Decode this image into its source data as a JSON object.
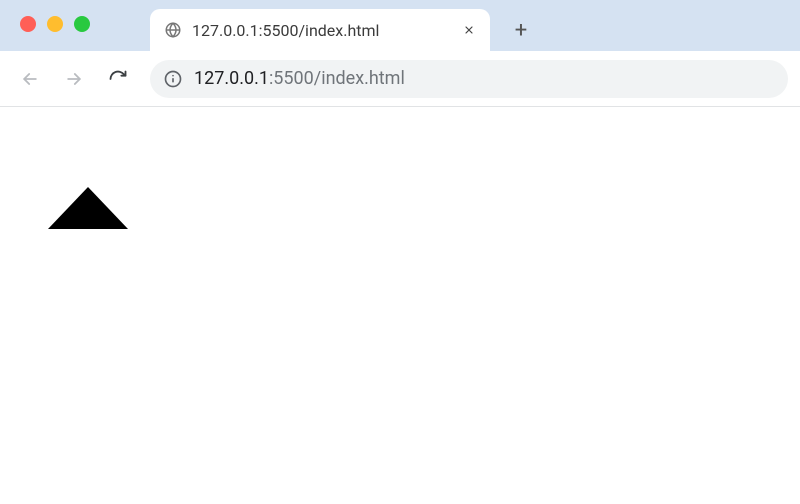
{
  "window": {
    "traffic_lights": {
      "close": "close",
      "minimize": "minimize",
      "maximize": "maximize"
    }
  },
  "tab": {
    "title": "127.0.0.1:5500/index.html",
    "favicon": "globe-icon",
    "close_label": "Close tab"
  },
  "newtab_label": "+",
  "toolbar": {
    "back_label": "Back",
    "forward_label": "Forward",
    "reload_label": "Reload",
    "site_info_label": "View site information"
  },
  "omnibox": {
    "host": "127.0.0.1",
    "path": ":5500/index.html"
  },
  "page": {
    "shape": "triangle-up"
  }
}
